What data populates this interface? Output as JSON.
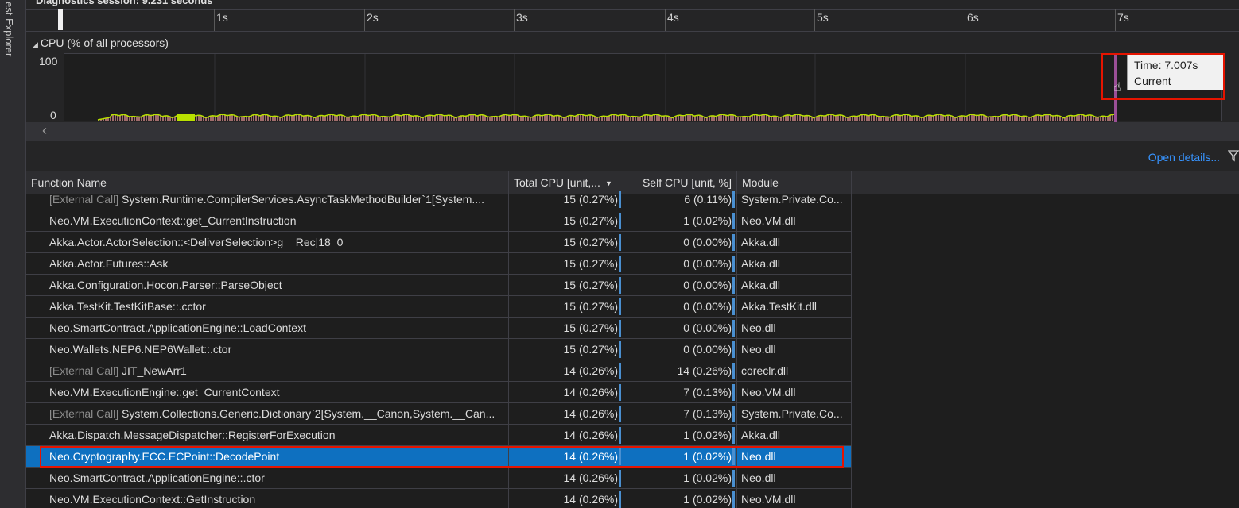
{
  "sidebar": {
    "vertical_label": "est Explorer"
  },
  "timeline": {
    "session_label": "Diagnostics session: 9.231 seconds",
    "ticks": [
      "1s",
      "2s",
      "3s",
      "4s",
      "5s",
      "6s",
      "7s"
    ]
  },
  "cpu_graph": {
    "title": "CPU (% of all processors)",
    "y_max_label": "100",
    "y_min_label": "0",
    "tooltip_time": "Time: 7.007s",
    "tooltip_context": "Current Function",
    "series_color": "#b9e000",
    "bar_color": "#c08080",
    "marker_color": "#9b4f96"
  },
  "toolbar": {
    "open_details_label": "Open details..."
  },
  "table": {
    "headers": {
      "function_name": "Function Name",
      "total_cpu": "Total CPU [unit,...",
      "self_cpu": "Self CPU [unit, %]",
      "module": "Module"
    },
    "rows": [
      {
        "prefix": "[External Call]",
        "name": " System.Runtime.CompilerServices.AsyncTaskMethodBuilder`1[System....",
        "total": "15 (0.27%)",
        "self": "6 (0.11%)",
        "module": "System.Private.Co..."
      },
      {
        "prefix": "",
        "name": "Neo.VM.ExecutionContext::get_CurrentInstruction",
        "total": "15 (0.27%)",
        "self": "1 (0.02%)",
        "module": "Neo.VM.dll"
      },
      {
        "prefix": "",
        "name": "Akka.Actor.ActorSelection::<DeliverSelection>g__Rec|18_0",
        "total": "15 (0.27%)",
        "self": "0 (0.00%)",
        "module": "Akka.dll"
      },
      {
        "prefix": "",
        "name": "Akka.Actor.Futures::Ask",
        "total": "15 (0.27%)",
        "self": "0 (0.00%)",
        "module": "Akka.dll"
      },
      {
        "prefix": "",
        "name": "Akka.Configuration.Hocon.Parser::ParseObject",
        "total": "15 (0.27%)",
        "self": "0 (0.00%)",
        "module": "Akka.dll"
      },
      {
        "prefix": "",
        "name": "Akka.TestKit.TestKitBase::.cctor",
        "total": "15 (0.27%)",
        "self": "0 (0.00%)",
        "module": "Akka.TestKit.dll"
      },
      {
        "prefix": "",
        "name": "Neo.SmartContract.ApplicationEngine::LoadContext",
        "total": "15 (0.27%)",
        "self": "0 (0.00%)",
        "module": "Neo.dll"
      },
      {
        "prefix": "",
        "name": "Neo.Wallets.NEP6.NEP6Wallet::.ctor",
        "total": "15 (0.27%)",
        "self": "0 (0.00%)",
        "module": "Neo.dll"
      },
      {
        "prefix": "[External Call]",
        "name": " JIT_NewArr1",
        "total": "14 (0.26%)",
        "self": "14 (0.26%)",
        "module": "coreclr.dll"
      },
      {
        "prefix": "",
        "name": "Neo.VM.ExecutionEngine::get_CurrentContext",
        "total": "14 (0.26%)",
        "self": "7 (0.13%)",
        "module": "Neo.VM.dll"
      },
      {
        "prefix": "[External Call]",
        "name": " System.Collections.Generic.Dictionary`2[System.__Canon,System.__Can...",
        "total": "14 (0.26%)",
        "self": "7 (0.13%)",
        "module": "System.Private.Co..."
      },
      {
        "prefix": "",
        "name": "Akka.Dispatch.MessageDispatcher::RegisterForExecution",
        "total": "14 (0.26%)",
        "self": "1 (0.02%)",
        "module": "Akka.dll"
      },
      {
        "prefix": "",
        "name": "Neo.Cryptography.ECC.ECPoint::DecodePoint",
        "total": "14 (0.26%)",
        "self": "1 (0.02%)",
        "module": "Neo.dll",
        "selected": true
      },
      {
        "prefix": "",
        "name": "Neo.SmartContract.ApplicationEngine::.ctor",
        "total": "14 (0.26%)",
        "self": "1 (0.02%)",
        "module": "Neo.dll"
      },
      {
        "prefix": "",
        "name": "Neo.VM.ExecutionContext::GetInstruction",
        "total": "14 (0.26%)",
        "self": "1 (0.02%)",
        "module": "Neo.VM.dll"
      }
    ]
  }
}
